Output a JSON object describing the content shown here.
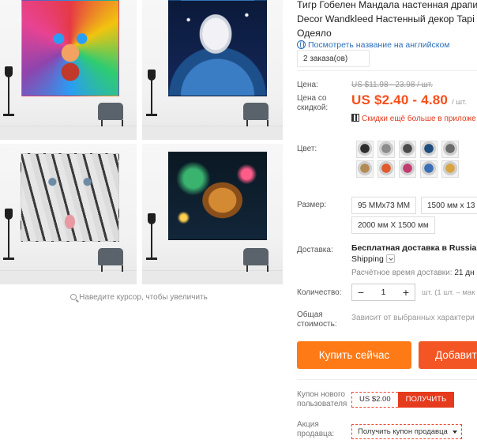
{
  "gallery": {
    "zoom_hint": "Наведите курсор, чтобы увеличить",
    "thumbnails": [
      {
        "subject": "rainbow-lion-tapestry",
        "colors": [
          "#e63946",
          "#f4a261",
          "#2a9df4",
          "#8e44ad",
          "#f1c40f"
        ]
      },
      {
        "subject": "white-tiger-earth-tapestry",
        "colors": [
          "#0b1a3a",
          "#2c5f9e",
          "#e8e8ee"
        ]
      },
      {
        "subject": "white-tiger-face-tapestry",
        "colors": [
          "#dedede",
          "#8a8a8a",
          "#2b2b2b"
        ]
      },
      {
        "subject": "lion-galaxy-tapestry",
        "colors": [
          "#0a1822",
          "#c47c2a",
          "#2ea36a"
        ]
      }
    ]
  },
  "product": {
    "title_lines": [
      "Тигр Гобелен Мандала настенная драпи",
      "Decor Wandkleed Настенный декор Tapi",
      "Одеяло"
    ],
    "translate_link": "Посмотреть название на английском",
    "orders": "2 заказа(ов)"
  },
  "price": {
    "label": "Цена:",
    "old": "US $11.98 - 23.98 / шт.",
    "discount_label_1": "Цена со",
    "discount_label_2": "скидкой:",
    "sale": "US $2.40 - 4.80",
    "unit": "/ шт.",
    "promo": "Скидки ещё больше в приложе"
  },
  "color": {
    "label": "Цвет:",
    "swatches": [
      "#2d2d2d",
      "#8c8c8c",
      "#4a4a4a",
      "#1f4c7a",
      "#6b6b6b",
      "#b28a55",
      "#e05a2b",
      "#c23b6e",
      "#3b6fb6",
      "#d9a441"
    ]
  },
  "size": {
    "label": "Размер:",
    "options": [
      "95 MMx73 MM",
      "1500 мм x 13",
      "2000 мм X 1500 мм"
    ]
  },
  "shipping": {
    "label": "Доставка:",
    "title": "Бесплатная доставка в Russian F",
    "method": "Shipping",
    "time_label": "Расчётное время доставки:",
    "time_value": "21 дн"
  },
  "quantity": {
    "label": "Количество:",
    "value": "1",
    "minus": "−",
    "plus": "+",
    "note": "шт. (1 шт. – мак"
  },
  "total": {
    "label_1": "Общая",
    "label_2": "стоимость:",
    "value": "Зависит от выбранных характери"
  },
  "actions": {
    "buy_now": "Купить сейчас",
    "add_to_cart": "Добавит"
  },
  "coupons": {
    "new_user_label_1": "Купон нового",
    "new_user_label_2": "пользователя",
    "new_user_value": "US $2.00",
    "get_label": "ПОЛУЧИТЬ",
    "seller_label_1": "Акция",
    "seller_label_2": "продавца:",
    "seller_select": "Получить купон продавца"
  }
}
